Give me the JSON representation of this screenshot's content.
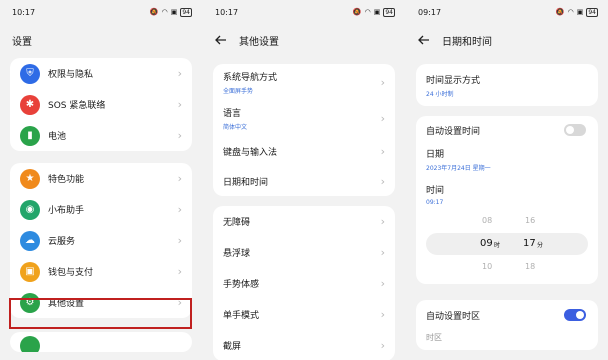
{
  "colors": {
    "accent": "#3b6fd8",
    "highlight": "#c0201f",
    "toggle_on": "#3b5ee0",
    "toggle_off": "#d8d8d8"
  },
  "screen1": {
    "status": {
      "time": "10:17",
      "battery": "94"
    },
    "title": "设置",
    "group1": [
      {
        "label": "权限与隐私",
        "icon": "shield-icon",
        "color": "#2e6be6",
        "glyph": "⛨"
      },
      {
        "label": "SOS 紧急联络",
        "icon": "asterisk-icon",
        "color": "#e8413a",
        "glyph": "✱"
      },
      {
        "label": "电池",
        "icon": "battery-icon",
        "color": "#2aa34a",
        "glyph": "▮"
      }
    ],
    "group2": [
      {
        "label": "特色功能",
        "icon": "star-icon",
        "color": "#f08a1c",
        "glyph": "★"
      },
      {
        "label": "小布助手",
        "icon": "assistant-icon",
        "color": "#22a56a",
        "glyph": "◉"
      },
      {
        "label": "云服务",
        "icon": "cloud-icon",
        "color": "#2e8be0",
        "glyph": "☁"
      },
      {
        "label": "钱包与支付",
        "icon": "wallet-icon",
        "color": "#f0a21c",
        "glyph": "▣"
      },
      {
        "label": "其他设置",
        "icon": "gear-icon",
        "color": "#2aa34a",
        "glyph": "⚙"
      }
    ]
  },
  "screen2": {
    "status": {
      "time": "10:17",
      "battery": "94"
    },
    "title": "其他设置",
    "group1": [
      {
        "label": "系统导航方式",
        "sub": "全面屏手势"
      },
      {
        "label": "语言",
        "sub": "简体中文"
      },
      {
        "label": "键盘与输入法",
        "sub": ""
      },
      {
        "label": "日期和时间",
        "sub": ""
      }
    ],
    "group2": [
      {
        "label": "无障碍"
      },
      {
        "label": "悬浮球"
      },
      {
        "label": "手势体感"
      },
      {
        "label": "单手模式"
      },
      {
        "label": "截屏"
      }
    ]
  },
  "screen3": {
    "status": {
      "time": "09:17",
      "battery": "94"
    },
    "title": "日期和时间",
    "time_format": {
      "label": "时间显示方式",
      "sub": "24 小时制"
    },
    "auto_time": {
      "label": "自动设置时间",
      "on": false
    },
    "date": {
      "label": "日期",
      "value": "2023年7月24日 星期一"
    },
    "time": {
      "label": "时间",
      "value": "09:17"
    },
    "picker": {
      "hour_above": "08",
      "hour": "09",
      "hour_unit": "时",
      "hour_below": "10",
      "minute_above": "16",
      "minute": "17",
      "minute_unit": "分",
      "minute_below": "18"
    },
    "auto_zone": {
      "label": "自动设置时区",
      "on": true
    },
    "next_label": "时区"
  }
}
